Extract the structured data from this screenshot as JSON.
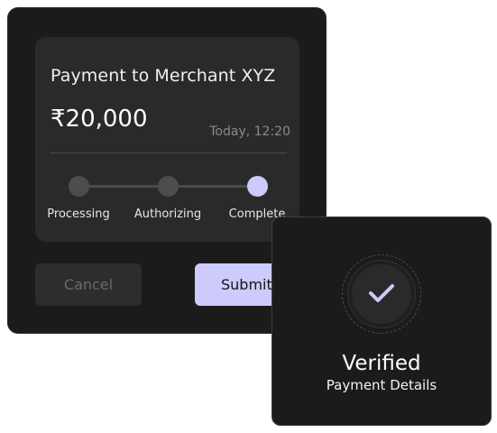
{
  "payment_card": {
    "title": "Payment to Merchant XYZ",
    "amount": "₹20,000",
    "timestamp": "Today, 12:20",
    "steps": [
      {
        "label": "Processing",
        "state": "done"
      },
      {
        "label": "Authorizing",
        "state": "done"
      },
      {
        "label": "Complete",
        "state": "active"
      }
    ],
    "cancel_label": "Cancel",
    "submit_label": "Submit"
  },
  "verified_card": {
    "icon": "checkmark-icon",
    "title": "Verified",
    "subtitle": "Payment Details"
  },
  "colors": {
    "accent": "#cdcafc",
    "card_bg": "#1b1b1b",
    "panel_bg": "#2a2a2a",
    "muted_text": "#8a8a8a"
  }
}
